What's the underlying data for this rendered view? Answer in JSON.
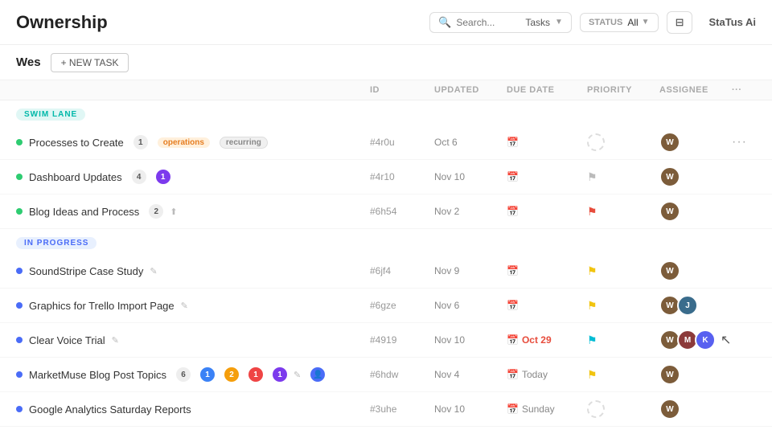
{
  "header": {
    "title": "Ownership",
    "search_placeholder": "Search...",
    "tasks_label": "Tasks",
    "status_label": "STATUS",
    "status_value": "All",
    "status_ai": "StaTus Ai"
  },
  "subheader": {
    "user": "Wes",
    "new_task_btn": "+ NEW TASK"
  },
  "table_headers": {
    "id": "ID",
    "updated": "UPDATED",
    "due_date": "DUE DATE",
    "priority": "PRIORITY",
    "assignee": "ASSIGNEE"
  },
  "swim_lane": {
    "label": "SWIM LANE",
    "tasks": [
      {
        "id": 1,
        "name": "Processes to Create",
        "dot": "green",
        "count": "1",
        "badges": [
          "operations",
          "recurring"
        ],
        "task_id": "#4r0u",
        "updated": "Oct 6",
        "due": "",
        "priority": "dashed",
        "assignee": [
          "a1"
        ]
      },
      {
        "id": 2,
        "name": "Dashboard Updates",
        "dot": "green",
        "count_gray": "4",
        "count_purple": "1",
        "badges": [],
        "task_id": "#4r10",
        "updated": "Nov 10",
        "due": "",
        "priority": "flag-gray",
        "assignee": [
          "a1"
        ]
      },
      {
        "id": 3,
        "name": "Blog Ideas and Process",
        "dot": "green",
        "count_gray": "2",
        "badges": [],
        "task_id": "#6h54",
        "updated": "Nov 2",
        "due": "",
        "priority": "flag-red",
        "assignee": [
          "a1"
        ]
      }
    ]
  },
  "in_progress": {
    "label": "IN PROGRESS",
    "tasks": [
      {
        "id": 1,
        "name": "SoundStripe Case Study",
        "dot": "blue",
        "badges": [],
        "task_id": "#6jf4",
        "updated": "Nov 9",
        "due": "",
        "priority": "flag-yellow",
        "assignee": [
          "a1"
        ],
        "edit_icon": true
      },
      {
        "id": 2,
        "name": "Graphics for Trello Import Page",
        "dot": "blue",
        "badges": [],
        "task_id": "#6gze",
        "updated": "Nov 6",
        "due": "",
        "priority": "flag-yellow",
        "assignee": [
          "a1",
          "a2"
        ],
        "edit_icon": true
      },
      {
        "id": 3,
        "name": "Clear Voice Trial",
        "dot": "blue",
        "badges": [],
        "task_id": "#4919",
        "updated": "Nov 10",
        "due": "Oct 29",
        "due_overdue": true,
        "priority": "flag-cyan",
        "assignee": [
          "a1",
          "a3",
          "a4"
        ],
        "edit_icon": true,
        "has_cursor": true
      },
      {
        "id": 4,
        "name": "MarketMuse Blog Post Topics",
        "dot": "blue",
        "badges": [],
        "count_gray": "6",
        "count_purple_b": "1",
        "count_orange": "2",
        "count_red": "1",
        "count_purple_c": "1",
        "task_id": "#6hdw",
        "updated": "Nov 4",
        "due": "Today",
        "priority": "flag-yellow",
        "assignee": [
          "a1"
        ],
        "edit_icon": true,
        "has_person_icon": true
      },
      {
        "id": 5,
        "name": "Google Analytics Saturday Reports",
        "dot": "blue",
        "badges": [],
        "task_id": "#3uhe",
        "updated": "Nov 10",
        "due": "Sunday",
        "priority": "dashed",
        "assignee": [
          "a1"
        ]
      }
    ]
  }
}
